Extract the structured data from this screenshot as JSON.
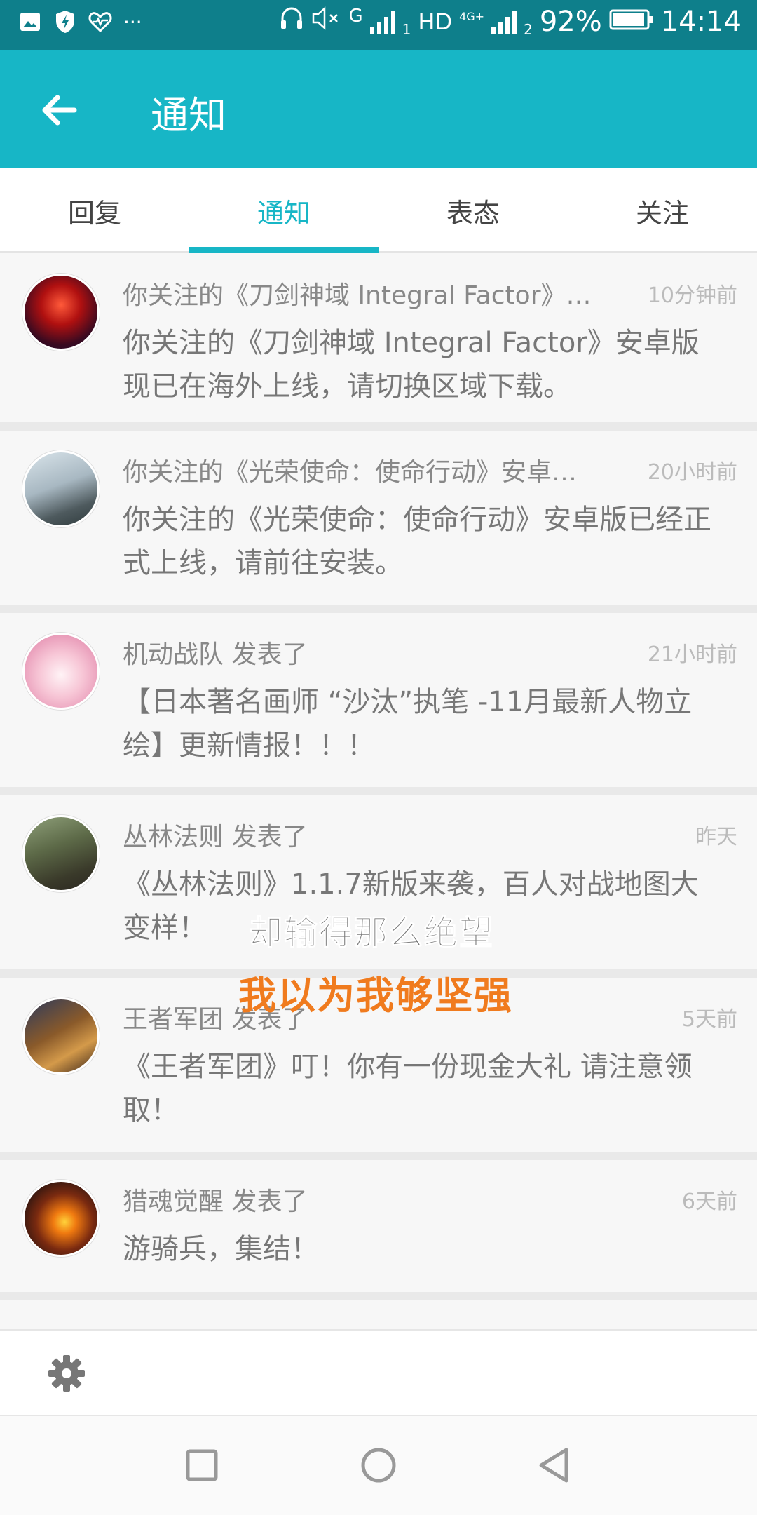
{
  "status_bar": {
    "network_label": "HD",
    "lte_label": "4G+",
    "sim1": "1",
    "sim2": "2",
    "g_label": "G",
    "battery": "92%",
    "time": "14:14",
    "more": "···"
  },
  "header": {
    "title": "通知"
  },
  "tabs": [
    {
      "label": "回复",
      "active": false
    },
    {
      "label": "通知",
      "active": true
    },
    {
      "label": "表态",
      "active": false
    },
    {
      "label": "关注",
      "active": false
    }
  ],
  "notifications": [
    {
      "title": "你关注的《刀剑神域 Integral Factor》…",
      "time": "10分钟前",
      "body": "你关注的《刀剑神域 Integral Factor》安卓版现已在海外上线，请切换区域下载。"
    },
    {
      "title": "你关注的《光荣使命：使命行动》安卓…",
      "time": "20小时前",
      "body": "你关注的《光荣使命：使命行动》安卓版已经正式上线，请前往安装。"
    },
    {
      "title": "机动战队 发表了",
      "time": "21小时前",
      "body": "【日本著名画师 “沙汰”执笔 -11月最新人物立绘】更新情报！！！"
    },
    {
      "title": "丛林法则 发表了",
      "time": "昨天",
      "body": "《丛林法则》1.1.7新版来袭，百人对战地图大变样！"
    },
    {
      "title": "王者军团 发表了",
      "time": "5天前",
      "body": "《王者军团》叮！你有一份现金大礼 请注意领取！"
    },
    {
      "title": "猎魂觉醒 发表了",
      "time": "6天前",
      "body": "游骑兵，集结！"
    }
  ],
  "overlay": {
    "line1": "却输得那么绝望",
    "line2": "我以为我够坚强"
  },
  "colors": {
    "accent": "#17b6c6",
    "status_bar": "#0e7f8b",
    "caption_orange": "#f07b1e"
  }
}
